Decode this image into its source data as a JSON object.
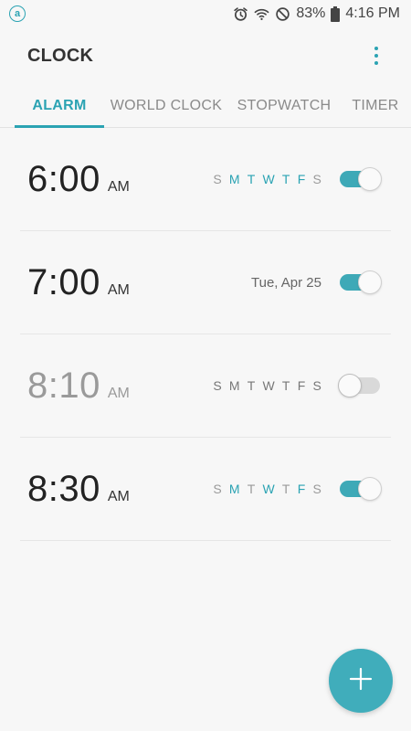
{
  "status_bar": {
    "app_badge": "a",
    "battery_percent": "83%",
    "time": "4:16 PM",
    "icons": [
      "alarm-icon",
      "wifi-icon",
      "do-not-disturb-icon",
      "battery-icon"
    ]
  },
  "app_bar": {
    "title": "CLOCK",
    "more_icon": "more-vertical-icon"
  },
  "tabs": [
    {
      "label": "ALARM",
      "active": true
    },
    {
      "label": "WORLD CLOCK",
      "active": false
    },
    {
      "label": "STOPWATCH",
      "active": false
    },
    {
      "label": "TIMER",
      "active": false
    }
  ],
  "alarms": [
    {
      "time": "6:00",
      "ampm": "AM",
      "enabled": true,
      "days": [
        {
          "label": "S",
          "on": false
        },
        {
          "label": "M",
          "on": true
        },
        {
          "label": "T",
          "on": true
        },
        {
          "label": "W",
          "on": true
        },
        {
          "label": "T",
          "on": true
        },
        {
          "label": "F",
          "on": true
        },
        {
          "label": "S",
          "on": false
        }
      ]
    },
    {
      "time": "7:00",
      "ampm": "AM",
      "enabled": true,
      "date": "Tue, Apr 25"
    },
    {
      "time": "8:10",
      "ampm": "AM",
      "enabled": false,
      "days": [
        {
          "label": "S",
          "on": false
        },
        {
          "label": "M",
          "on": false
        },
        {
          "label": "T",
          "on": false
        },
        {
          "label": "W",
          "on": false
        },
        {
          "label": "T",
          "on": false
        },
        {
          "label": "F",
          "on": false
        },
        {
          "label": "S",
          "on": false
        }
      ]
    },
    {
      "time": "8:30",
      "ampm": "AM",
      "enabled": true,
      "days": [
        {
          "label": "S",
          "on": false
        },
        {
          "label": "M",
          "on": true
        },
        {
          "label": "T",
          "on": false
        },
        {
          "label": "W",
          "on": true
        },
        {
          "label": "T",
          "on": false
        },
        {
          "label": "F",
          "on": true
        },
        {
          "label": "S",
          "on": false
        }
      ]
    }
  ],
  "fab": {
    "icon": "plus-icon"
  },
  "colors": {
    "accent": "#2ba3b3",
    "fab": "#40adbb",
    "toggle_on": "#3ea9b7",
    "toggle_off": "#d9d9d9"
  }
}
